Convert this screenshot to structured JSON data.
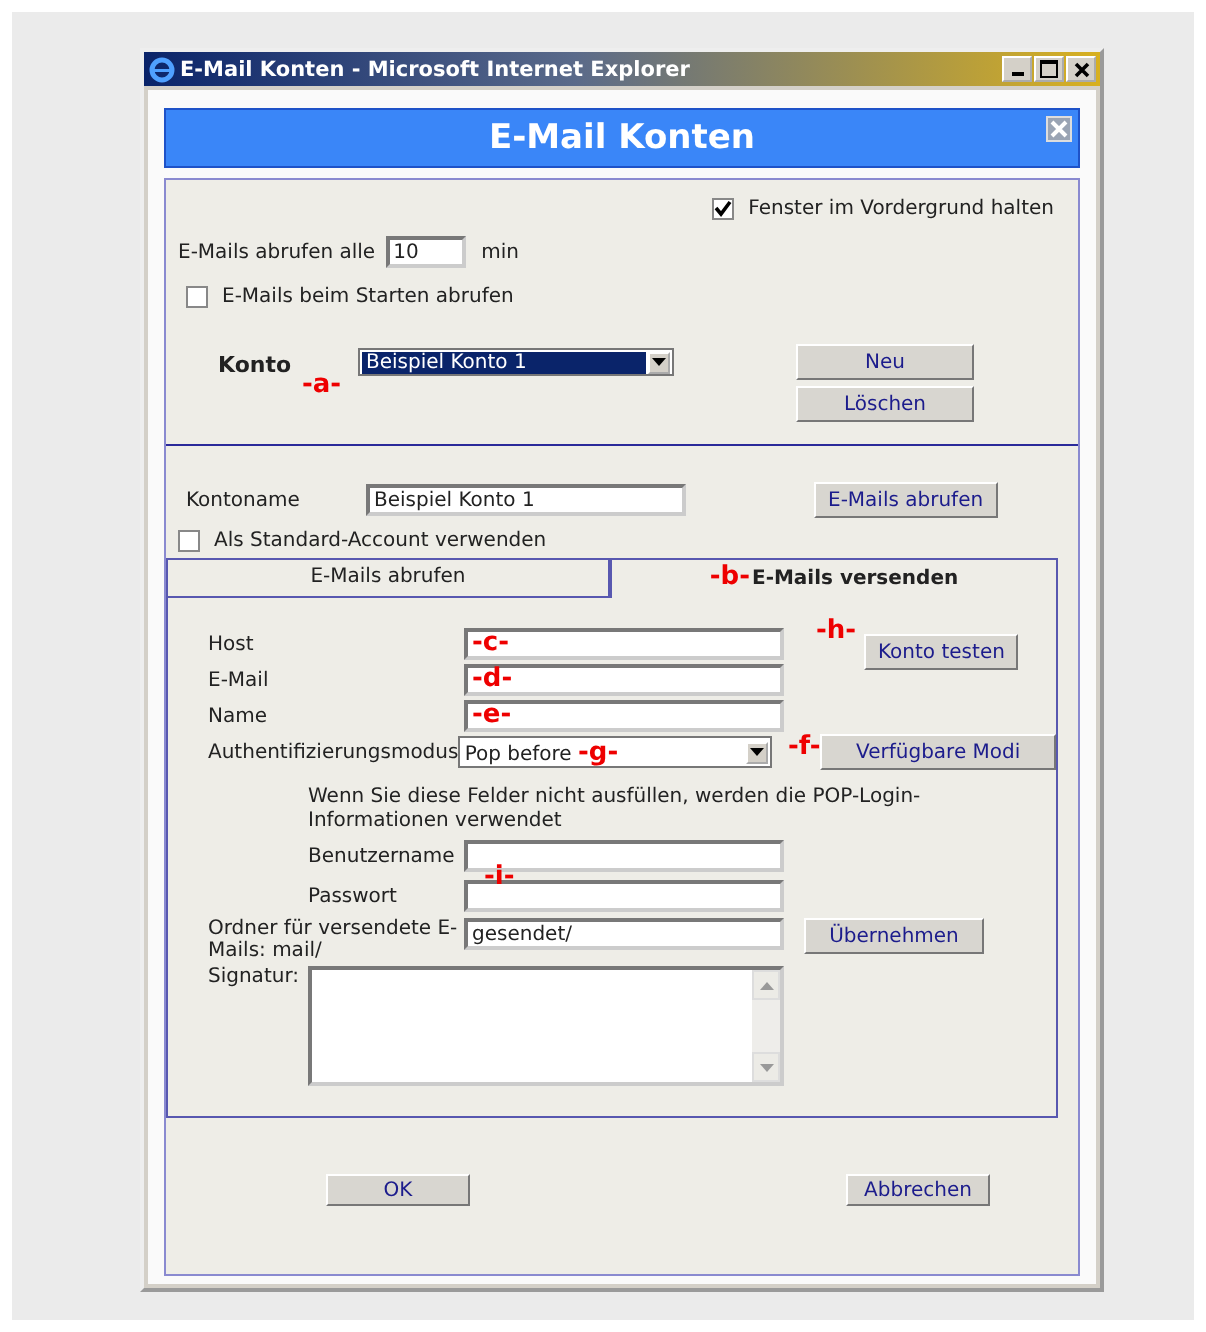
{
  "window": {
    "title": "E-Mail Konten - Microsoft Internet Explorer"
  },
  "header": {
    "title": "E-Mail Konten"
  },
  "keep_on_top": {
    "label": "Fenster im Vordergrund halten",
    "checked": true
  },
  "interval": {
    "label": "E-Mails abrufen alle",
    "value": "10",
    "unit": "min"
  },
  "fetch_on_start": {
    "label": "E-Mails beim Starten abrufen",
    "checked": false
  },
  "account": {
    "label": "Konto",
    "value": "Beispiel Konto 1",
    "callout": "-a-"
  },
  "account_buttons": [
    "Neu",
    "Löschen"
  ],
  "account_name": {
    "label": "Kontoname",
    "value": "Beispiel Konto 1",
    "button": "E-Mails abrufen"
  },
  "default_account": {
    "label": "Als Standard-Account verwenden",
    "checked": false
  },
  "tabs": [
    {
      "label": "E-Mails abrufen",
      "selected": false
    },
    {
      "label": "E-Mails versenden",
      "selected": true,
      "callout": "-b-"
    }
  ],
  "fields": [
    {
      "label": "Host",
      "callout": "-c-"
    },
    {
      "label": "E-Mail",
      "callout": "-d-"
    },
    {
      "label": "Name",
      "callout": "-e-"
    }
  ],
  "test_button": {
    "label": "Konto testen",
    "callout": "-h-"
  },
  "auth": {
    "label": "Authentifizierungsmodus",
    "value": "Pop before",
    "callout": "-g-",
    "button": "Verfügbare Modi",
    "button_callout": "-f-"
  },
  "note": "Wenn Sie diese Felder nicht ausfüllen, werden die POP-Login-Informationen verwendet",
  "credentials": [
    {
      "label": "Benutzername"
    },
    {
      "label": "Passwort",
      "callout": "-i-"
    }
  ],
  "folder": {
    "label": "Ordner für versendete E-Mails: mail/",
    "value": "gesendet/",
    "button": "Übernehmen"
  },
  "signature": {
    "label": "Signatur:"
  },
  "buttons": [
    "OK",
    "Abbrechen"
  ]
}
